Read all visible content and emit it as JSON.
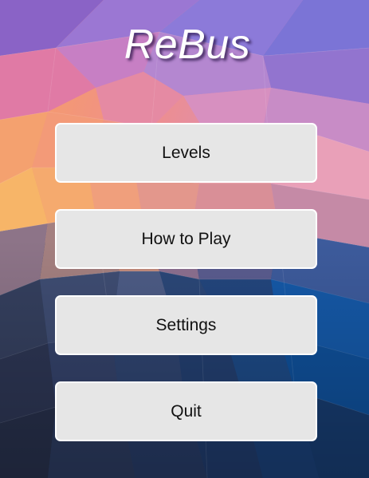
{
  "title": "ReBus",
  "menu": {
    "levels_label": "Levels",
    "how_to_play_label": "How to Play",
    "settings_label": "Settings",
    "quit_label": "Quit"
  }
}
